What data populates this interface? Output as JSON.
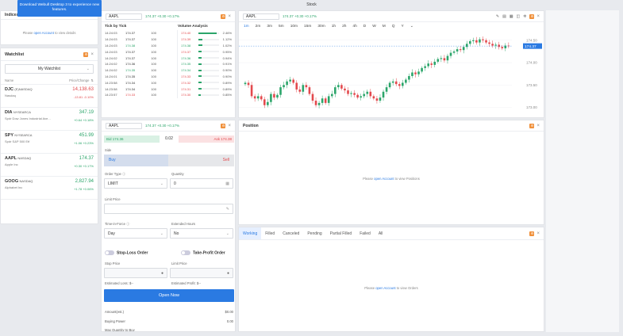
{
  "window_title": "Stock",
  "banner": {
    "line1": "Download Webull Desktop 3 to experience new",
    "line2": "features."
  },
  "indices": {
    "header_label": "Indices",
    "login_prefix": "Please",
    "login_link": "open Account",
    "login_suffix": "to view details"
  },
  "watchlist": {
    "title": "Watchlist",
    "selector": "My Watchlist",
    "col_name": "Name",
    "col_price": "Price/Change",
    "col_price_arrow": "⇅",
    "items": [
      {
        "sym": "DJC",
        "ex": "(E)NASDAQ",
        "desc": "Nasdaq",
        "price": "14,138.63",
        "chg": "-13.81 -0.10%",
        "dir": "down"
      },
      {
        "sym": "DIA",
        "ex": "NYSEARCA",
        "desc": "Spdr Dow Jones Industrial Ave...",
        "price": "347.19",
        "chg": "+0.64 +0.18%",
        "dir": "up"
      },
      {
        "sym": "SPY",
        "ex": "NYSEARCA",
        "desc": "Spdr S&P 500 Etf",
        "price": "451.99",
        "chg": "+1.06 +0.23%",
        "dir": "up"
      },
      {
        "sym": "AAPL",
        "ex": "NASDAQ",
        "desc": "Apple Inc",
        "price": "174.37",
        "chg": "+0.30 +0.17%",
        "dir": "up"
      },
      {
        "sym": "GOOG",
        "ex": "NASDAQ",
        "desc": "Alphabet Inc",
        "price": "2,827.94",
        "chg": "+1.78 +0.06%",
        "dir": "up"
      }
    ]
  },
  "tick_panel": {
    "symbol": "AAPL",
    "quote": "174.37 +0.30 +0.17%",
    "tick_title": "Tick by Tick",
    "va_title": "Volume Analysis",
    "ticks": [
      {
        "t": "14:24:03",
        "p": "174.37",
        "v": "100",
        "dir": "flat"
      },
      {
        "t": "14:24:03",
        "p": "174.37",
        "v": "100",
        "dir": "flat"
      },
      {
        "t": "14:24:03",
        "p": "174.38",
        "v": "100",
        "dir": "up"
      },
      {
        "t": "14:24:03",
        "p": "174.37",
        "v": "100",
        "dir": "flat"
      },
      {
        "t": "14:24:02",
        "p": "174.37",
        "v": "100",
        "dir": "flat"
      },
      {
        "t": "14:24:02",
        "p": "174.36",
        "v": "100",
        "dir": "flat"
      },
      {
        "t": "14:24:02",
        "p": "174.35",
        "v": "100",
        "dir": "up"
      },
      {
        "t": "14:24:01",
        "p": "174.35",
        "v": "100",
        "dir": "flat"
      },
      {
        "t": "14:23:58",
        "p": "174.34",
        "v": "100",
        "dir": "flat"
      },
      {
        "t": "14:23:58",
        "p": "174.34",
        "v": "100",
        "dir": "flat"
      },
      {
        "t": "14:23:57",
        "p": "174.33",
        "v": "100",
        "dir": "down"
      }
    ],
    "volume": [
      {
        "p": "174.40",
        "pct": "2.46%",
        "frac": 0.9,
        "dir": "down"
      },
      {
        "p": "174.39",
        "pct": "1.12%",
        "frac": 0.2,
        "dir": "down"
      },
      {
        "p": "174.38",
        "pct": "1.02%",
        "frac": 0.18,
        "dir": "up"
      },
      {
        "p": "174.37",
        "pct": "0.95%",
        "frac": 0.16,
        "dir": "down"
      },
      {
        "p": "174.36",
        "pct": "0.94%",
        "frac": 0.16,
        "dir": "up"
      },
      {
        "p": "174.35",
        "pct": "0.91%",
        "frac": 0.15,
        "dir": "up"
      },
      {
        "p": "174.34",
        "pct": "0.90%",
        "frac": 0.15,
        "dir": "up"
      },
      {
        "p": "174.33",
        "pct": "0.90%",
        "frac": 0.15,
        "dir": "down"
      },
      {
        "p": "174.32",
        "pct": "0.89%",
        "frac": 0.14,
        "dir": "down"
      },
      {
        "p": "174.31",
        "pct": "0.89%",
        "frac": 0.14,
        "dir": "down"
      },
      {
        "p": "174.30",
        "pct": "0.85%",
        "frac": 0.13,
        "dir": "down"
      }
    ]
  },
  "chart_panel": {
    "symbol": "AAPL",
    "quote": "174.37 +0.30 +0.17%",
    "timeframes": [
      "1m",
      "2m",
      "3m",
      "5m",
      "10m",
      "15m",
      "30m",
      "1h",
      "2h",
      "4h",
      "D",
      "W",
      "M",
      "Q",
      "Y"
    ],
    "active_tf": "1m"
  },
  "chart_data": {
    "type": "candlestick",
    "yticks": [
      174.5,
      174.0,
      173.5,
      173.0
    ],
    "ylim": [
      172.85,
      174.62
    ],
    "last_price": "174.37",
    "closes": [
      173.55,
      173.5,
      173.25,
      173.2,
      173.25,
      173.18,
      173.05,
      173.12,
      173.3,
      173.22,
      173.28,
      173.45,
      173.5,
      173.58,
      173.62,
      173.55,
      173.4,
      173.35,
      173.5,
      173.45,
      173.3,
      173.15,
      173.05,
      173.1,
      173.2,
      173.1,
      173.25,
      173.3,
      173.45,
      173.5,
      173.42,
      173.38,
      173.3,
      173.32,
      173.28,
      173.22,
      173.25,
      173.3,
      173.35,
      173.25,
      173.2,
      173.15,
      173.22,
      173.35,
      173.45,
      173.55,
      173.58,
      173.52,
      173.48,
      173.55,
      173.62,
      173.7,
      173.78,
      173.74,
      173.8,
      173.88,
      173.92,
      173.98,
      173.95,
      174.02,
      174.08,
      174.1,
      174.05,
      174.15,
      174.22,
      174.25,
      174.3,
      174.28,
      174.35,
      174.42,
      174.48,
      174.5,
      174.45,
      174.52,
      174.5,
      174.45,
      174.42,
      174.38,
      174.4,
      174.35,
      174.32,
      174.38,
      174.37
    ]
  },
  "order_panel": {
    "symbol": "AAPL",
    "quote": "174.37 +0.30 +0.17%",
    "bid": "Bid 174.36",
    "spread": "0.02",
    "ask": "Ask 174.38",
    "side_label": "Side",
    "buy": "Buy",
    "sell": "Sell",
    "order_type_label": "Order Type",
    "order_type": "LIMIT",
    "quantity_label": "Quantity",
    "quantity": "0",
    "limit_price_label": "Limit Price",
    "tif_label": "Time-in-Force",
    "tif": "Day",
    "ext_label": "Extended Hours",
    "ext": "No",
    "stop_loss": "Stop-Loss Order",
    "take_profit": "Take-Profit Order",
    "stop_price_label": "Stop Price",
    "limit_price2_label": "Limit Price",
    "est_loss": "Estimated Loss: $--",
    "est_profit": "Estimated Profit: $--",
    "open_now": "Open Now",
    "amount_label": "Amount(est.)",
    "amount_val": "$0.00",
    "bp_label": "Buying Power",
    "bp_val": "0.00",
    "max_label": "Max Quantity to Buy"
  },
  "position_panel": {
    "title": "Position",
    "msg_prefix": "Please",
    "msg_link": "open Account",
    "msg_suffix": "to view Positions"
  },
  "orders_panel": {
    "tabs": [
      "Working",
      "Filled",
      "Canceled",
      "Pending",
      "Partial Filled",
      "Failed",
      "All"
    ],
    "msg_prefix": "Please",
    "msg_link": "open Account",
    "msg_suffix": "to view Orders"
  },
  "colors": {
    "up": "#2ba56a",
    "down": "#e3494d",
    "accent": "#2a7ae2",
    "banner": "#2a7ae2"
  }
}
